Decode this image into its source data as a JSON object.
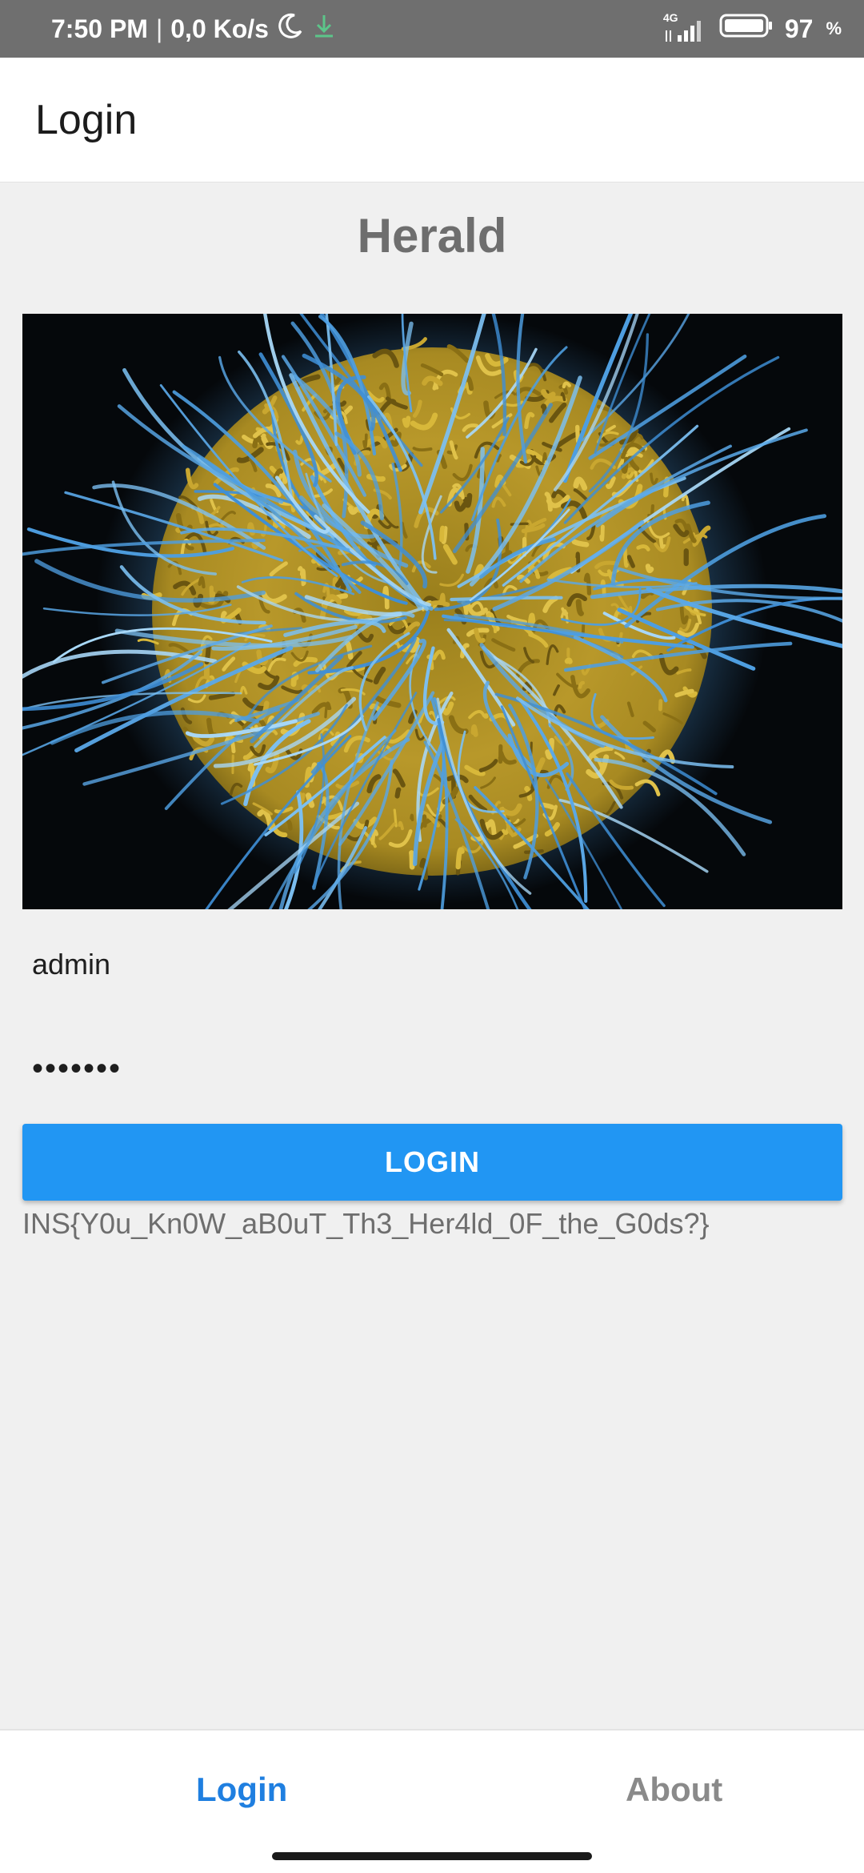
{
  "status_bar": {
    "time": "7:50 PM",
    "separator": "|",
    "net_speed": "0,0 Ko/s",
    "network_type": "4G",
    "battery_level": "97",
    "battery_unit": "%",
    "icons": [
      "moon-icon",
      "download-icon",
      "signal-icon",
      "battery-icon"
    ]
  },
  "app_bar": {
    "title": "Login"
  },
  "main": {
    "app_name": "Herald",
    "username_value": "admin",
    "password_value": "•••••••",
    "login_button_label": "LOGIN",
    "flag_text": "INS{Y0u_Kn0W_aB0uT_Th3_Her4ld_0F_the_G0ds?}"
  },
  "bottom_nav": {
    "items": [
      {
        "label": "Login",
        "active": true
      },
      {
        "label": "About",
        "active": false
      }
    ]
  },
  "colors": {
    "accent": "#2196f3",
    "active_tab": "#1f7fe0",
    "inactive_tab": "#8a8a8a",
    "muted_text": "#6e6e6e",
    "background": "#f0f0f0"
  }
}
